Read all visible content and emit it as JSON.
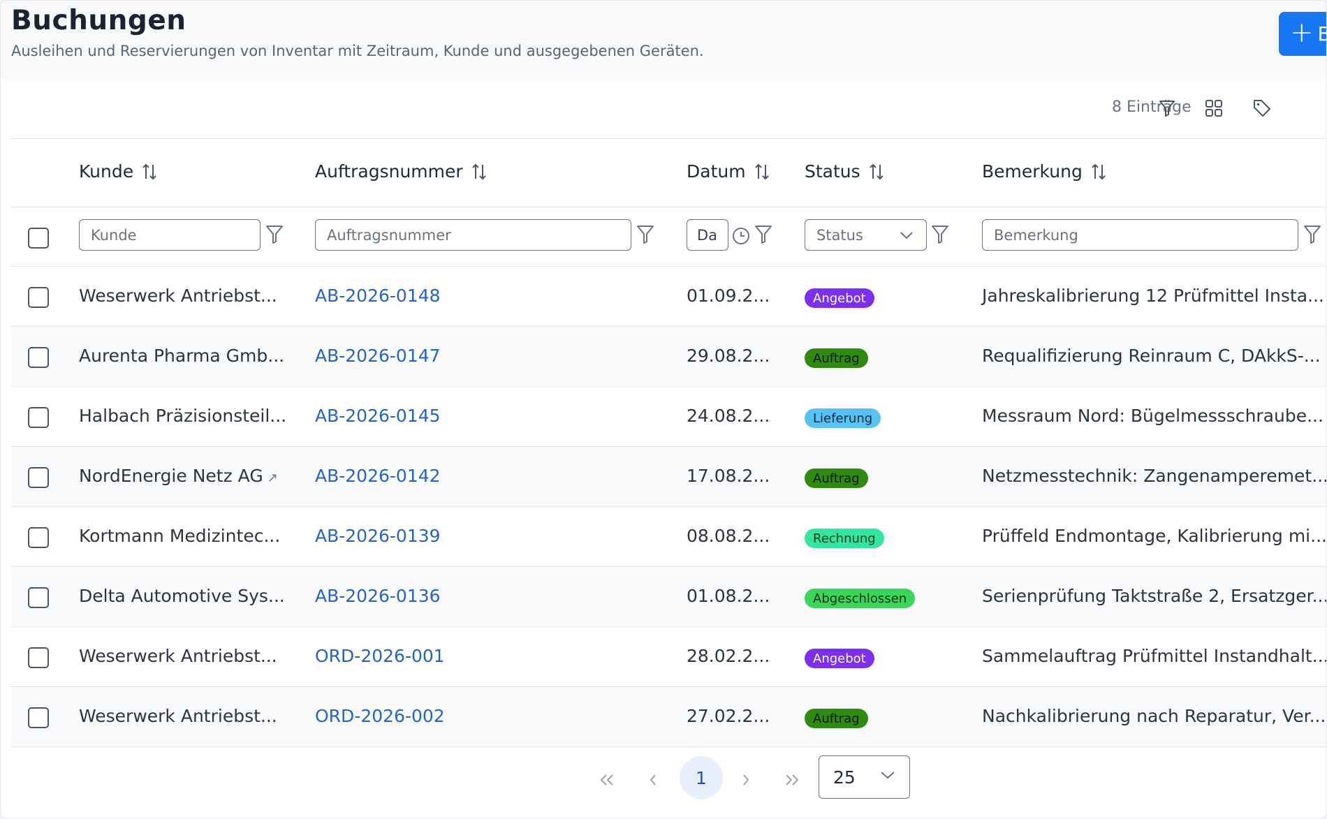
{
  "page": {
    "title": "Buchungen",
    "subtitle": "Ausleihen und Reservierungen von Inventar mit Zeitraum, Kunde und ausgegebenen Geräten.",
    "add_button_label": "B"
  },
  "toolbar": {
    "entries_count": "8 Einträge",
    "icons": [
      "filter-icon",
      "grid-view-icon",
      "tag-icon"
    ]
  },
  "table": {
    "columns": [
      {
        "label": "Kunde",
        "filter_placeholder": "Kunde"
      },
      {
        "label": "Auftragsnummer",
        "filter_placeholder": "Auftragsnummer"
      },
      {
        "label": "Datum",
        "filter_placeholder": "Da"
      },
      {
        "label": "Status",
        "filter_placeholder": "Status"
      },
      {
        "label": "Bemerkung",
        "filter_placeholder": "Bemerkung"
      }
    ],
    "rows": [
      {
        "kunde": "Weserwerk Antriebst...",
        "auftragsnummer": "AB-2026-0148",
        "datum": "01.09.2...",
        "status": "Angebot",
        "bemerkung": "Jahreskalibrierung 12 Prüfmittel Insta...",
        "ext_link": false
      },
      {
        "kunde": "Aurenta Pharma Gmb...",
        "auftragsnummer": "AB-2026-0147",
        "datum": "29.08.2...",
        "status": "Auftrag",
        "bemerkung": "Requalifizierung Reinraum C, DAkkS-...",
        "ext_link": false
      },
      {
        "kunde": "Halbach Präzisionsteil...",
        "auftragsnummer": "AB-2026-0145",
        "datum": "24.08.2...",
        "status": "Lieferung",
        "bemerkung": "Messraum Nord: Bügelmessschraube...",
        "ext_link": false
      },
      {
        "kunde": "NordEnergie Netz AG",
        "auftragsnummer": "AB-2026-0142",
        "datum": "17.08.2...",
        "status": "Auftrag",
        "bemerkung": "Netzmesstechnik: Zangenamperemet...",
        "ext_link": true
      },
      {
        "kunde": "Kortmann Medizintec...",
        "auftragsnummer": "AB-2026-0139",
        "datum": "08.08.2...",
        "status": "Rechnung",
        "bemerkung": "Prüffeld Endmontage, Kalibrierung mi...",
        "ext_link": false
      },
      {
        "kunde": "Delta Automotive Sys...",
        "auftragsnummer": "AB-2026-0136",
        "datum": "01.08.2...",
        "status": "Abgeschlossen",
        "bemerkung": "Serienprüfung Taktstraße 2, Ersatzger...",
        "ext_link": false
      },
      {
        "kunde": "Weserwerk Antriebst...",
        "auftragsnummer": "ORD-2026-001",
        "datum": "28.02.2...",
        "status": "Angebot",
        "bemerkung": "Sammelauftrag Prüfmittel Instandhalt...",
        "ext_link": false
      },
      {
        "kunde": "Weserwerk Antriebst...",
        "auftragsnummer": "ORD-2026-002",
        "datum": "27.02.2...",
        "status": "Auftrag",
        "bemerkung": "Nachkalibrierung nach Reparatur, Ver...",
        "ext_link": false
      }
    ]
  },
  "status_colors": {
    "Angebot": {
      "bg": "#7c2ff0",
      "fg": "#ffffff"
    },
    "Auftrag": {
      "bg": "#2f8a10",
      "fg": "#0b1a05"
    },
    "Lieferung": {
      "bg": "#55c4f5",
      "fg": "#0c2740"
    },
    "Rechnung": {
      "bg": "#33e6a0",
      "fg": "#073a26"
    },
    "Abgeschlossen": {
      "bg": "#3ad65a",
      "fg": "#06320f"
    }
  },
  "pagination": {
    "current_page": "1",
    "page_size": "25",
    "first_label": "«",
    "prev_label": "‹",
    "next_label": "›",
    "last_label": "»"
  },
  "colors": {
    "accent": "#1877f2",
    "link": "#2563c9"
  }
}
